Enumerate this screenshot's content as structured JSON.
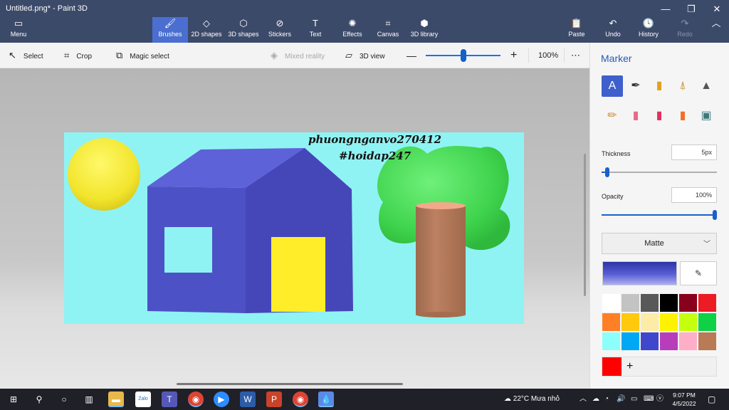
{
  "window": {
    "title": "Untitled.png* - Paint 3D"
  },
  "titlebar_buttons": [
    {
      "name": "minimize-button",
      "glyph": "—"
    },
    {
      "name": "maximize-button",
      "glyph": "❐"
    },
    {
      "name": "close-button",
      "glyph": "✕"
    }
  ],
  "ribbon": {
    "menu_label": "Menu",
    "tools": [
      {
        "label": "Brushes",
        "icon": "brush-icon",
        "glyph": "🖌"
      },
      {
        "label": "2D shapes",
        "icon": "shapes-2d-icon",
        "glyph": "◇"
      },
      {
        "label": "3D shapes",
        "icon": "cube-icon",
        "glyph": "⬡"
      },
      {
        "label": "Stickers",
        "icon": "sticker-icon",
        "glyph": "⊘"
      },
      {
        "label": "Text",
        "icon": "text-icon",
        "glyph": "T"
      },
      {
        "label": "Effects",
        "icon": "effects-icon",
        "glyph": "✺"
      },
      {
        "label": "Canvas",
        "icon": "canvas-icon",
        "glyph": "⌗"
      },
      {
        "label": "3D library",
        "icon": "library-icon",
        "glyph": "⬢"
      }
    ],
    "paste_label": "Paste",
    "undo_label": "Undo",
    "history_label": "History",
    "redo_label": "Redo"
  },
  "subtoolbar": {
    "select_label": "Select",
    "crop_label": "Crop",
    "magic_select_label": "Magic select",
    "mixed_reality_label": "Mixed reality",
    "view3d_label": "3D view",
    "zoom_level": "100%"
  },
  "canvas": {
    "watermark_line1": "phuongnganvo270412",
    "watermark_line2": "#hoidap247"
  },
  "panel": {
    "title": "Marker",
    "brushes_row1": [
      "marker-icon",
      "calligraphy-pen-icon",
      "oil-brush-icon",
      "watercolor-icon",
      "pixel-pen-icon"
    ],
    "brushes_row2": [
      "pencil-icon",
      "eraser-icon",
      "crayon-icon",
      "spray-can-icon",
      "fill-bucket-icon"
    ],
    "thickness_label": "Thickness",
    "thickness_value": "5px",
    "opacity_label": "Opacity",
    "opacity_value": "100%",
    "finish_value": "Matte",
    "current_color": "#ff0000",
    "palette": [
      "#ffffff",
      "#c3c3c3",
      "#585858",
      "#000000",
      "#88001b",
      "#ec1c24",
      "#ff7f27",
      "#ffc90e",
      "#fdeca6",
      "#fff200",
      "#c4ff0e",
      "#0ed145",
      "#8cfffb",
      "#00a8f3",
      "#3f48cc",
      "#b83dba",
      "#ffaec8",
      "#b97a56"
    ]
  },
  "taskbar": {
    "weather": "22°C  Mưa nhỏ",
    "time": "9:07 PM",
    "date": "4/5/2022"
  }
}
